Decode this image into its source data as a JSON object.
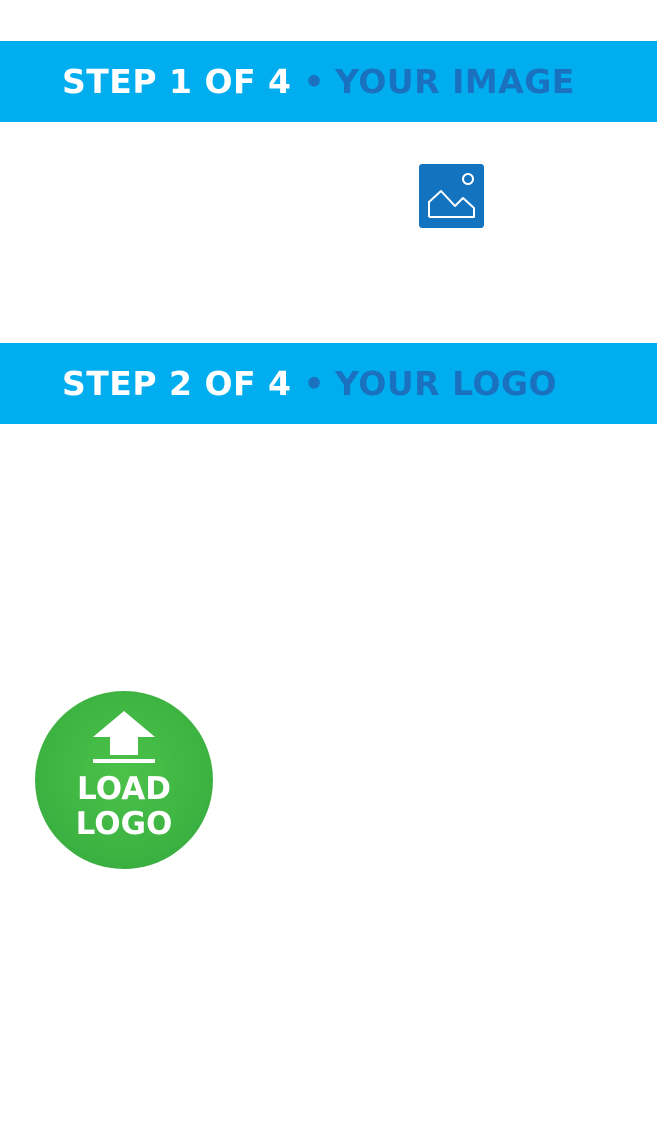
{
  "steps": [
    {
      "number_label": "STEP 1 OF 4",
      "bullet": "•",
      "name": "YOUR IMAGE"
    },
    {
      "number_label": "STEP 2 OF 4",
      "bullet": "•",
      "name": "YOUR LOGO"
    }
  ],
  "image_picker": {
    "icon": "image-icon"
  },
  "load_logo": {
    "line1": "LOAD",
    "line2": "LOGO",
    "icon": "upload-arrow-icon"
  },
  "colors": {
    "step_bar": "#00aeef",
    "step_accent": "#1a71c0",
    "image_icon_bg": "#1473bf",
    "load_logo_green": "#3db442"
  }
}
